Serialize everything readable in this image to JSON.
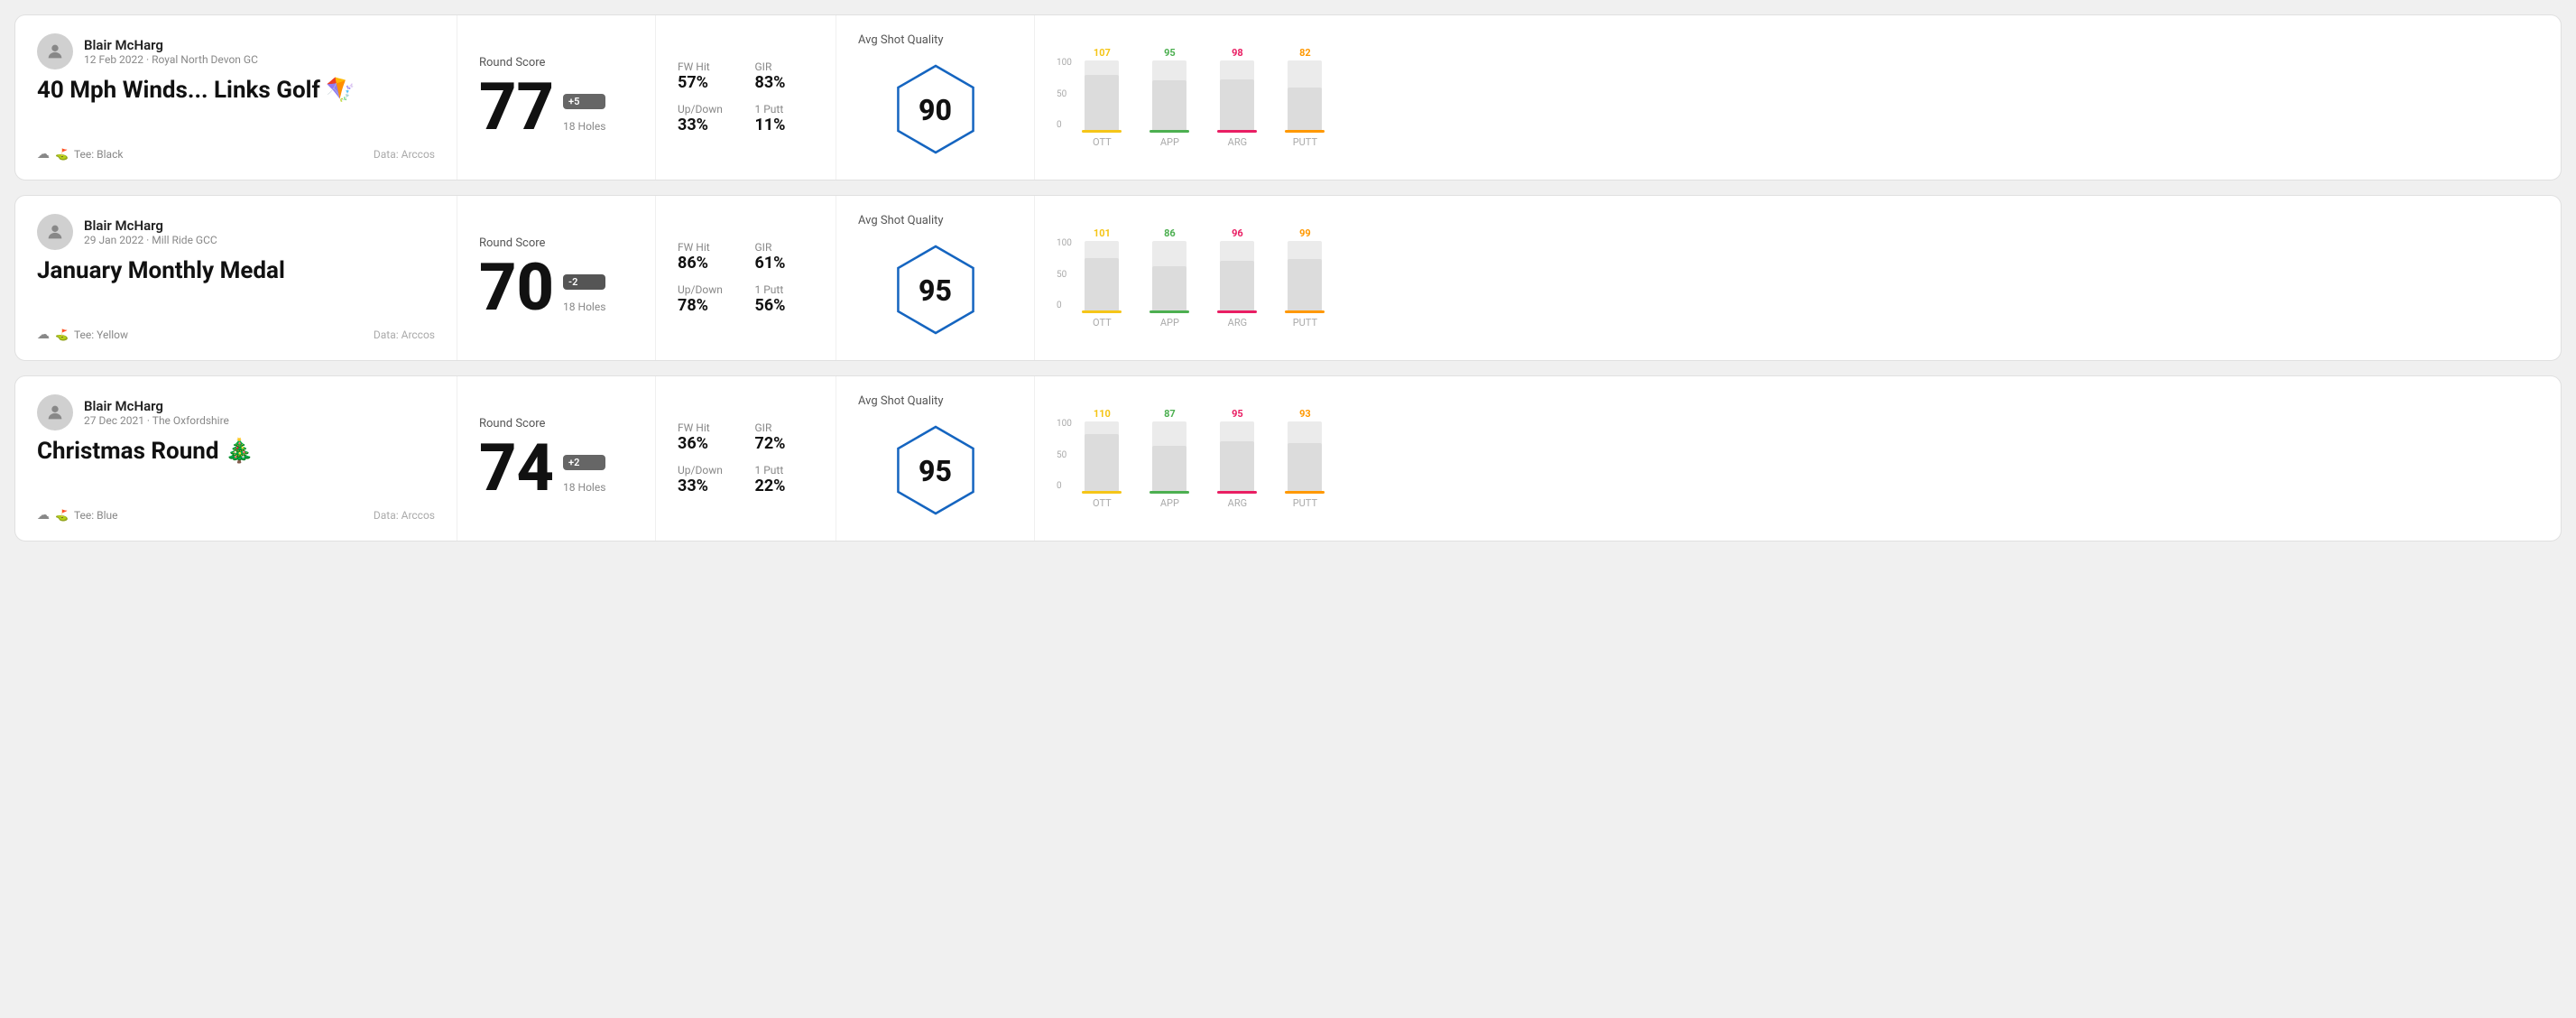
{
  "rounds": [
    {
      "id": "round1",
      "player": {
        "name": "Blair McHarg",
        "date": "12 Feb 2022 · Royal North Devon GC"
      },
      "title": "40 Mph Winds... Links Golf 🪁",
      "tee": "Black",
      "data_source": "Data: Arccos",
      "score": {
        "label": "Round Score",
        "number": "77",
        "badge": "+5",
        "badge_type": "positive",
        "holes": "18 Holes"
      },
      "stats": [
        {
          "label": "FW Hit",
          "value": "57%"
        },
        {
          "label": "GIR",
          "value": "83%"
        },
        {
          "label": "Up/Down",
          "value": "33%"
        },
        {
          "label": "1 Putt",
          "value": "11%"
        }
      ],
      "quality": {
        "label": "Avg Shot Quality",
        "score": "90"
      },
      "chart": {
        "bars": [
          {
            "label": "OTT",
            "value": 107,
            "color": "#f5c518",
            "height_pct": 80
          },
          {
            "label": "APP",
            "value": 95,
            "color": "#4caf50",
            "height_pct": 72
          },
          {
            "label": "ARG",
            "value": 98,
            "color": "#e91e63",
            "height_pct": 74
          },
          {
            "label": "PUTT",
            "value": 82,
            "color": "#ff9800",
            "height_pct": 62
          }
        ]
      }
    },
    {
      "id": "round2",
      "player": {
        "name": "Blair McHarg",
        "date": "29 Jan 2022 · Mill Ride GCC"
      },
      "title": "January Monthly Medal",
      "tee": "Yellow",
      "data_source": "Data: Arccos",
      "score": {
        "label": "Round Score",
        "number": "70",
        "badge": "-2",
        "badge_type": "negative",
        "holes": "18 Holes"
      },
      "stats": [
        {
          "label": "FW Hit",
          "value": "86%"
        },
        {
          "label": "GIR",
          "value": "61%"
        },
        {
          "label": "Up/Down",
          "value": "78%"
        },
        {
          "label": "1 Putt",
          "value": "56%"
        }
      ],
      "quality": {
        "label": "Avg Shot Quality",
        "score": "95"
      },
      "chart": {
        "bars": [
          {
            "label": "OTT",
            "value": 101,
            "color": "#f5c518",
            "height_pct": 76
          },
          {
            "label": "APP",
            "value": 86,
            "color": "#4caf50",
            "height_pct": 65
          },
          {
            "label": "ARG",
            "value": 96,
            "color": "#e91e63",
            "height_pct": 73
          },
          {
            "label": "PUTT",
            "value": 99,
            "color": "#ff9800",
            "height_pct": 75
          }
        ]
      }
    },
    {
      "id": "round3",
      "player": {
        "name": "Blair McHarg",
        "date": "27 Dec 2021 · The Oxfordshire"
      },
      "title": "Christmas Round 🎄",
      "tee": "Blue",
      "data_source": "Data: Arccos",
      "score": {
        "label": "Round Score",
        "number": "74",
        "badge": "+2",
        "badge_type": "positive",
        "holes": "18 Holes"
      },
      "stats": [
        {
          "label": "FW Hit",
          "value": "36%"
        },
        {
          "label": "GIR",
          "value": "72%"
        },
        {
          "label": "Up/Down",
          "value": "33%"
        },
        {
          "label": "1 Putt",
          "value": "22%"
        }
      ],
      "quality": {
        "label": "Avg Shot Quality",
        "score": "95"
      },
      "chart": {
        "bars": [
          {
            "label": "OTT",
            "value": 110,
            "color": "#f5c518",
            "height_pct": 83
          },
          {
            "label": "APP",
            "value": 87,
            "color": "#4caf50",
            "height_pct": 66
          },
          {
            "label": "ARG",
            "value": 95,
            "color": "#e91e63",
            "height_pct": 72
          },
          {
            "label": "PUTT",
            "value": 93,
            "color": "#ff9800",
            "height_pct": 70
          }
        ]
      }
    }
  ],
  "y_axis_labels": [
    "100",
    "50",
    "0"
  ]
}
